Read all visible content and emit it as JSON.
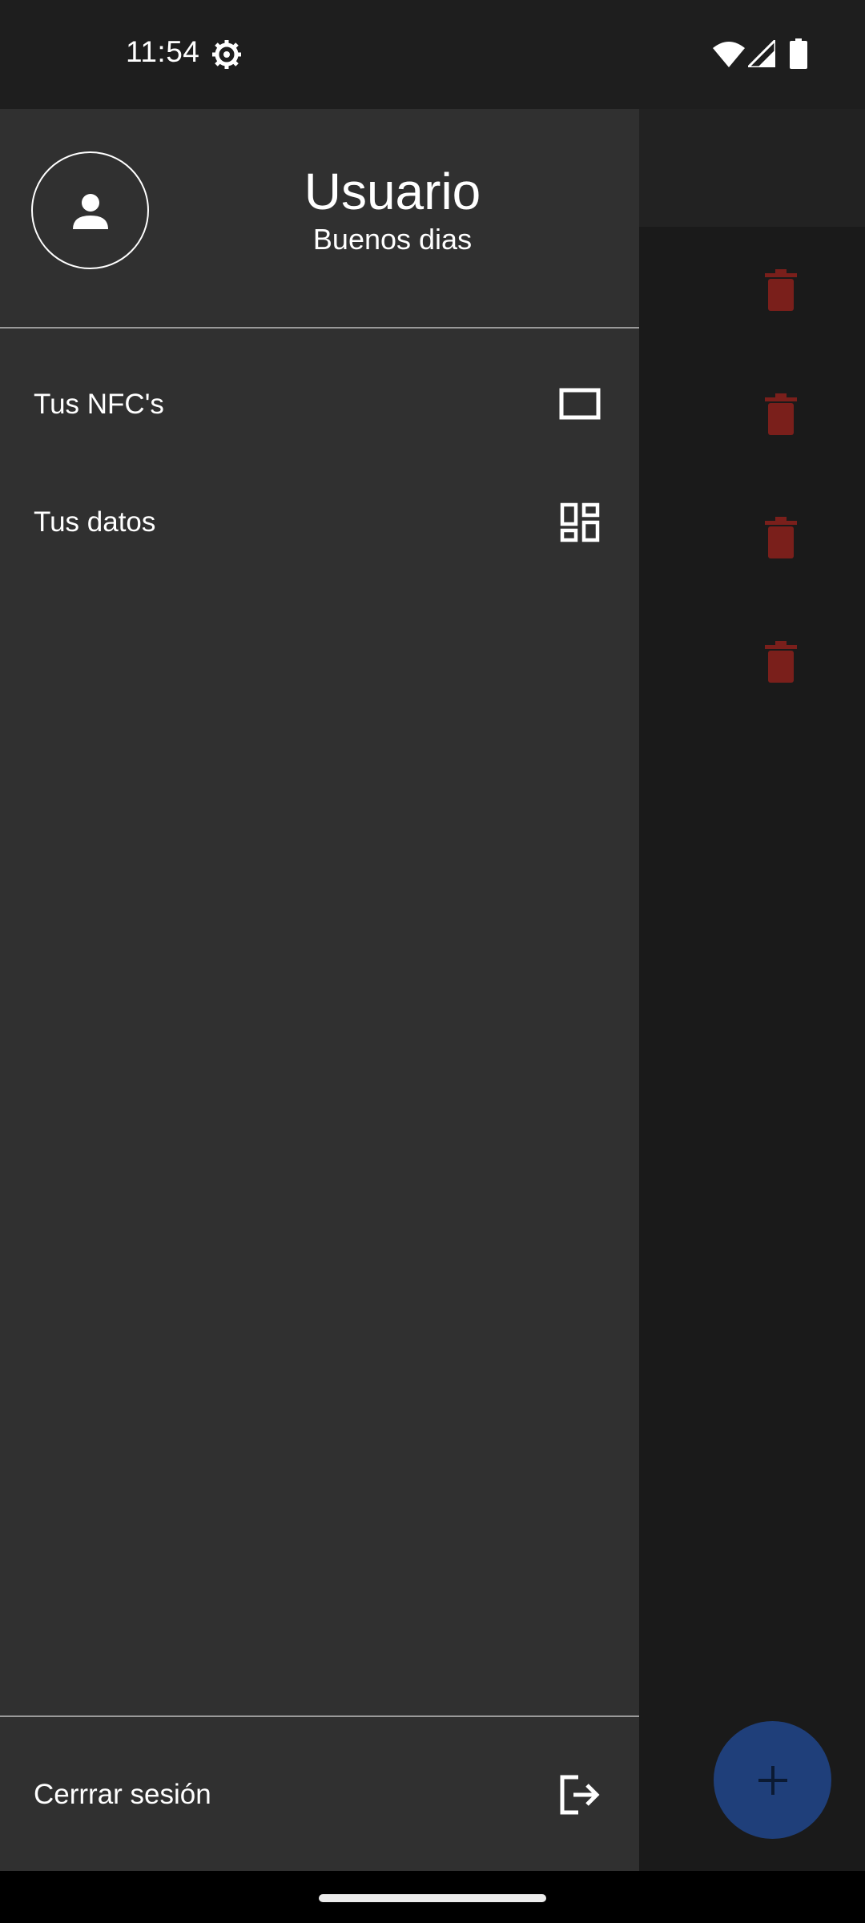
{
  "status_bar": {
    "time": "11:54",
    "icons": [
      "gear-icon",
      "wifi-icon",
      "signal-icon",
      "battery-icon"
    ]
  },
  "drawer": {
    "user": {
      "name": "Usuario",
      "greeting": "Buenos dias",
      "avatar_icon": "person-icon"
    },
    "menu": [
      {
        "label": "Tus NFC's",
        "icon": "card-outline-icon"
      },
      {
        "label": "Tus datos",
        "icon": "dashboard-icon"
      }
    ],
    "footer": {
      "label": "Cerrrar sesión",
      "icon": "logout-icon"
    }
  },
  "background": {
    "trash_icon_color": "#7a1f1b",
    "fab_color": "#1f3f7a",
    "fab_icon": "plus-icon"
  },
  "colors": {
    "drawer_bg": "#303030",
    "scrim_bg": "#1a1a1a"
  }
}
